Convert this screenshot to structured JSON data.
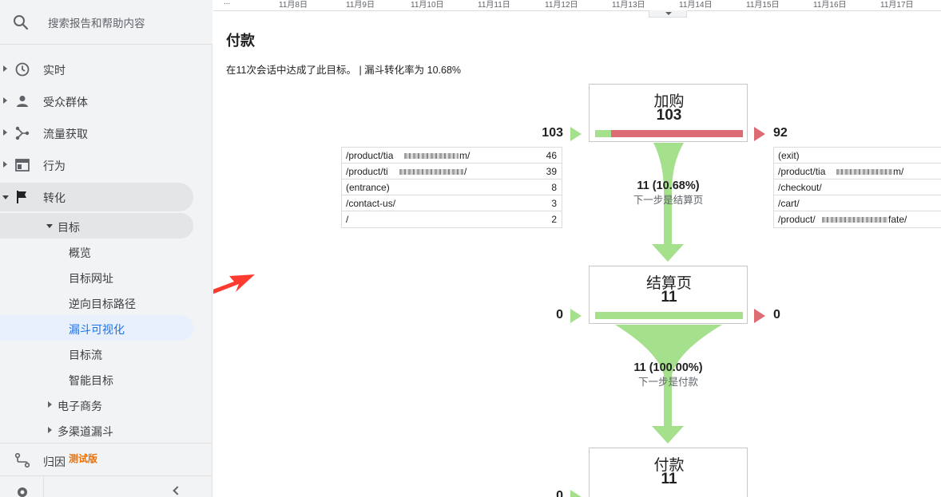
{
  "search": {
    "placeholder": "搜索报告和帮助内容",
    "icon": "search-icon"
  },
  "nav": [
    {
      "label": "实时",
      "icon": "clock-icon"
    },
    {
      "label": "受众群体",
      "icon": "person-icon"
    },
    {
      "label": "流量获取",
      "icon": "acquisition-icon"
    },
    {
      "label": "行为",
      "icon": "behavior-icon"
    },
    {
      "label": "转化",
      "icon": "flag-icon"
    }
  ],
  "conversion_sub": {
    "goals_label": "目标",
    "goal_items": [
      "概览",
      "目标网址",
      "逆向目标路径",
      "漏斗可视化",
      "目标流",
      "智能目标"
    ],
    "active_item": "漏斗可视化",
    "ecommerce_label": "电子商务",
    "multichannel_label": "多渠道漏斗"
  },
  "attribution": {
    "label": "归因",
    "badge": "测试版",
    "icon": "attribution-icon"
  },
  "bottom": {
    "settings_icon": "gear-icon",
    "collapse_icon": "chevron-left-icon"
  },
  "timeline": {
    "leading": "...",
    "dates": [
      "11月8日",
      "11月9日",
      "11月10日",
      "11月11日",
      "11月12日",
      "11月13日",
      "11月14日",
      "11月15日",
      "11月16日",
      "11月17日"
    ]
  },
  "report": {
    "title": "付款",
    "summary": "在11次会话中达成了此目标。 | 漏斗转化率为 10.68%"
  },
  "funnel": {
    "stages": [
      {
        "name": "加购",
        "count": "103",
        "entrances": "103",
        "exits": "92",
        "proceed_fraction": 0.107
      },
      {
        "name": "结算页",
        "count": "11",
        "entrances": "0",
        "exits": "0",
        "proceed_fraction": 1.0
      },
      {
        "name": "付款",
        "count": "11",
        "entrances": "0"
      }
    ],
    "conversions": [
      {
        "pct": "11 (10.68%)",
        "next": "下一步是结算页"
      },
      {
        "pct": "11 (100.00%)",
        "next": "下一步是付款"
      }
    ],
    "entrance_sources": [
      {
        "path": "/product/tia",
        "value": "46",
        "redacted_tail": "m/"
      },
      {
        "path": "/product/ti",
        "value": "39",
        "redacted_tail": "/"
      },
      {
        "path": "(entrance)",
        "value": "8"
      },
      {
        "path": "/contact-us/",
        "value": "3"
      },
      {
        "path": "/",
        "value": "2"
      }
    ],
    "exit_destinations": [
      {
        "path": "(exit)"
      },
      {
        "path": "/product/tia",
        "redacted_tail": "m/"
      },
      {
        "path": "/checkout/"
      },
      {
        "path": "/cart/"
      },
      {
        "path": "/product/",
        "redacted_tail": "fate/"
      }
    ]
  },
  "colors": {
    "proceed": "#a5e08c",
    "exit": "#dd6b74",
    "active_nav": "#1a73e8",
    "beta": "#e8710a",
    "annotation_arrow": "#ff3b30"
  }
}
